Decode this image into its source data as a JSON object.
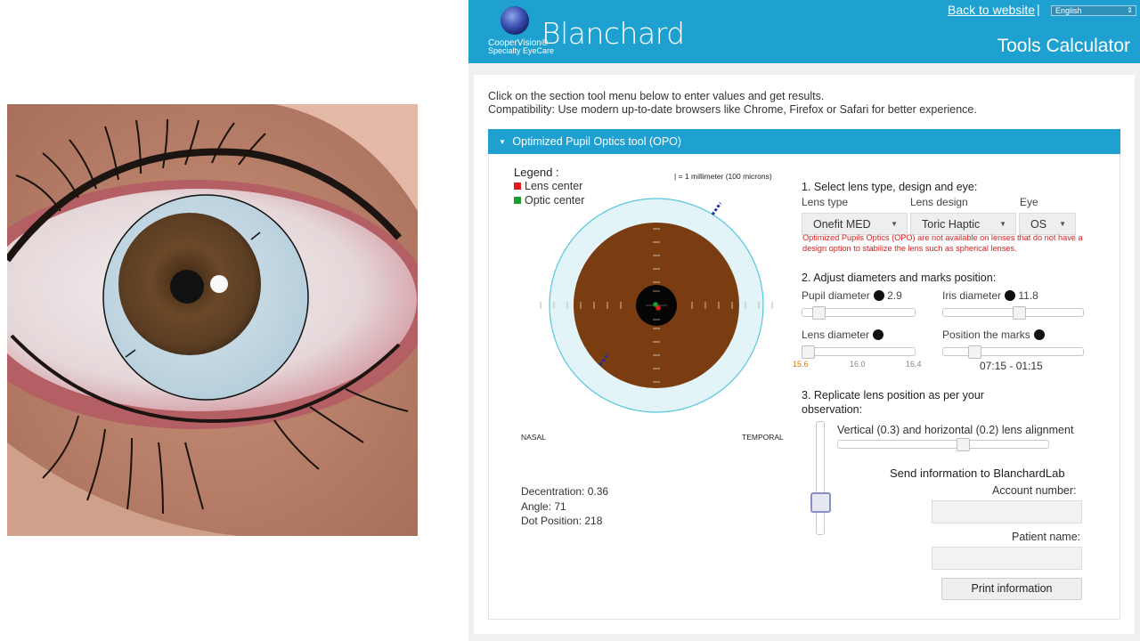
{
  "header": {
    "brand_small": "CooperVision",
    "brand_tagline": "Specialty EyeCare",
    "brand_name": "Blanchard",
    "back_link": "Back to website",
    "separator": "|",
    "language": "English",
    "page_title": "Tools Calculator"
  },
  "intro": {
    "line1": "Click on the section tool menu below to enter values and get results.",
    "line2": "Compatibility: Use modern up-to-date browsers like Chrome, Firefox or Safari for better experience."
  },
  "section": {
    "title": "Optimized Pupil Optics tool (OPO)"
  },
  "legend": {
    "title": "Legend :",
    "lens_center": "Lens center",
    "optic_center": "Optic center",
    "lens_center_color": "#e01b1b",
    "optic_center_color": "#1a9e2b",
    "scale_note": "| = 1 millimeter (100 microns)"
  },
  "diagram": {
    "nasal": "NASAL",
    "temporal": "TEMPORAL",
    "iris_color": "#7a3d12",
    "lens_color": "#e3f4f8",
    "ring_color": "#56c6dd"
  },
  "results": {
    "decentration": "Decentration: 0.36",
    "angle": "Angle: 71",
    "dot_position": "Dot Position: 218"
  },
  "step1": {
    "title": "1. Select lens type, design and eye:",
    "lens_type_label": "Lens type",
    "lens_design_label": "Lens design",
    "eye_label": "Eye",
    "lens_type_value": "Onefit MED",
    "lens_design_value": "Toric Haptic",
    "eye_value": "OS",
    "warning": "Optimized Pupils Optics (OPO) are not available on lenses that do not have a design option to stabilize the lens such as spherical lenses."
  },
  "step2": {
    "title": "2. Adjust diameters and marks position:",
    "pupil_label": "Pupil diameter",
    "pupil_value": "2.9",
    "pupil_level": 0.11,
    "iris_label": "Iris diameter",
    "iris_value": "11.8",
    "iris_level": 0.55,
    "lens_label": "Lens diameter",
    "lens_ticks": [
      "15.6",
      "16.0",
      "16.4"
    ],
    "lens_level": 0.0,
    "marks_label": "Position the marks",
    "marks_value": "07:15 - 01:15",
    "marks_level": 0.2
  },
  "step3": {
    "title_line1": "3. Replicate lens position as per your",
    "title_line2": "observation:",
    "align_label": "Vertical (0.3) and horizontal (0.2) lens alignment",
    "horizontal_level": 0.6,
    "vertical_level": 0.7
  },
  "send": {
    "title": "Send information to BlanchardLab",
    "account_label": "Account number:",
    "account_value": "",
    "patient_label": "Patient name:",
    "patient_value": "",
    "print_button": "Print information"
  }
}
